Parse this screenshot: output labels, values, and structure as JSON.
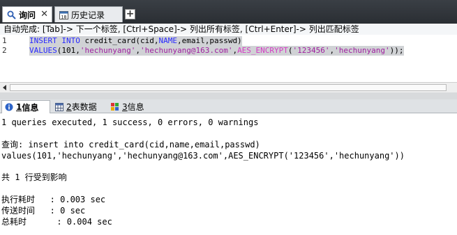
{
  "tabs": {
    "query_label": "询问",
    "history_label": "历史记录",
    "add_label": "+"
  },
  "hint": "自动完成: [Tab]-> 下一个标签, [Ctrl+Space]-> 列出所有标签, [Ctrl+Enter]-> 列出匹配标签",
  "editor": {
    "line_numbers": [
      "1",
      "2"
    ],
    "line1": {
      "kw1": "INSERT",
      "kw2": "INTO",
      "t1": " credit_card(cid,",
      "kw3": "NAME",
      "t2": ",email,passwd)"
    },
    "line2": {
      "kw1": "VALUES",
      "t1": "(101,",
      "s1": "'hechunyang'",
      "t2": ",",
      "s2": "'hechunyang@163.com'",
      "t3": ",",
      "fn": "AES_ENCRYPT",
      "t4": "(",
      "s3": "'123456'",
      "t5": ",",
      "s4": "'hechunyang'",
      "t6": "));"
    }
  },
  "bottom_tabs": [
    {
      "num": "1",
      "label": " 信息"
    },
    {
      "num": "2",
      "label": " 表数据"
    },
    {
      "num": "3",
      "label": " 信息"
    }
  ],
  "output": {
    "summary": "1 queries executed, 1 success, 0 errors, 0 warnings",
    "query_line1": "查询: insert into credit_card(cid,name,email,passwd)",
    "query_line2": "values(101,'hechunyang','hechunyang@163.com',AES_ENCRYPT('123456','hechunyang'))",
    "affected": "共 1 行受到影响",
    "exec_time": "执行耗时   : 0.003 sec",
    "transfer_time": "传送时间   : 0 sec",
    "total_time": "总耗时      : 0.004 sec"
  },
  "colors": {
    "keyword": "#2a2aff",
    "string": "#a020a0",
    "function": "#d43bc4",
    "selection": "#d0d2d5"
  }
}
